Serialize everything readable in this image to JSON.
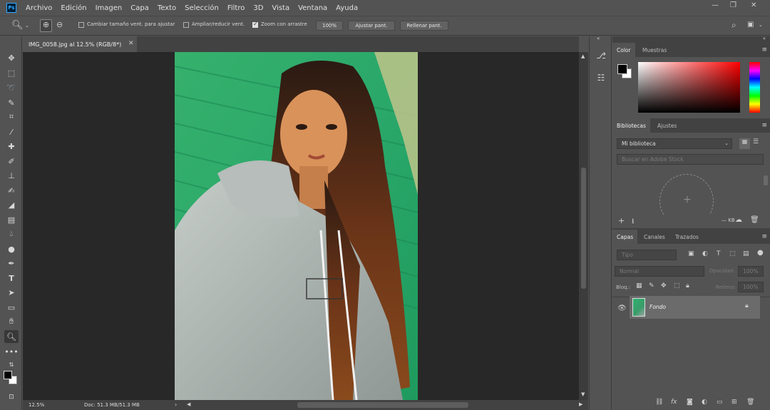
{
  "app": {
    "logo_text": "Ps"
  },
  "menu": [
    "Archivo",
    "Edición",
    "Imagen",
    "Capa",
    "Texto",
    "Selección",
    "Filtro",
    "3D",
    "Vista",
    "Ventana",
    "Ayuda"
  ],
  "window_controls": {
    "minimize": "—",
    "restore": "❐",
    "close": "✕"
  },
  "options": {
    "resize_windows_label": "Cambiar tamaño vent. para ajustar",
    "zoom_all_label": "Ampliar/reducir vent.",
    "scrubby_zoom_label": "Zoom con arrastre",
    "scrubby_zoom_checked": true,
    "zoom_100": "100%",
    "fit_screen": "Ajustar pant.",
    "fill_screen": "Rellenar pant."
  },
  "document": {
    "tab_title": "IMG_0058.jpg al 12.5% (RGB/8*)",
    "close": "✕"
  },
  "status": {
    "zoom": "12.5%",
    "doc_size": "Doc: 51.3 MB/51.3 MB"
  },
  "color_panel": {
    "tabs": [
      "Color",
      "Muestras"
    ],
    "foreground": "#000000",
    "background": "#ffffff"
  },
  "libraries_panel": {
    "tabs": [
      "Bibliotecas",
      "Ajustes"
    ],
    "library_select": "Mi biblioteca",
    "search_placeholder": "Buscar en Adobe Stock",
    "size_label": "— KB"
  },
  "layers_panel": {
    "tabs": [
      "Capas",
      "Canales",
      "Trazados"
    ],
    "filter_placeholder": "Tipo",
    "blend_mode": "Normal",
    "opacity_label": "Opacidad:",
    "opacity_value": "100%",
    "lock_label": "Bloq.:",
    "fill_label": "Relleno:",
    "fill_value": "100%",
    "layers": [
      {
        "name": "Fondo",
        "visible": true,
        "locked": true
      }
    ]
  }
}
